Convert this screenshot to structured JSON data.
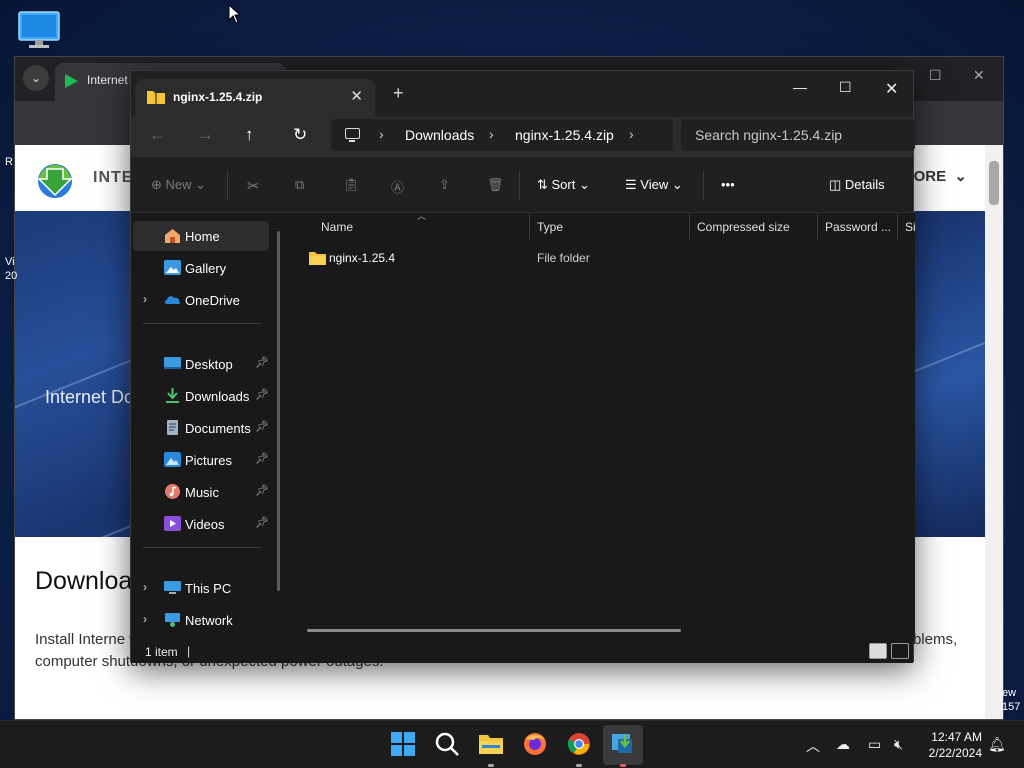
{
  "browser": {
    "tab_title": "Internet",
    "site_name": "INTE",
    "site_more": "ORE",
    "hero_text": "Internet Do",
    "download_title": "Downloa",
    "body_text": "Install Interne                                                                                                     wnloads your files. IDM will also repair broken and resume interrupted downloads due to lost connections, network problems, computer shutdowns, or unexpected power outages.",
    "left_cut": {
      "r": "R",
      "vi": "Vi",
      "num": "20"
    },
    "right_cut": {
      "line1": "ew",
      "line2": "157"
    }
  },
  "explorer": {
    "tab_title": "nginx-1.25.4.zip",
    "breadcrumb": [
      "Downloads",
      "nginx-1.25.4.zip"
    ],
    "search_placeholder": "Search nginx-1.25.4.zip",
    "commands": {
      "new": "New",
      "sort": "Sort",
      "view": "View",
      "more": "•••",
      "details": "Details"
    },
    "nav": {
      "home": "Home",
      "gallery": "Gallery",
      "onedrive": "OneDrive",
      "desktop": "Desktop",
      "downloads": "Downloads",
      "documents": "Documents",
      "pictures": "Pictures",
      "music": "Music",
      "videos": "Videos",
      "thispc": "This PC",
      "network": "Network"
    },
    "columns": [
      "Name",
      "Type",
      "Compressed size",
      "Password ...",
      "Si"
    ],
    "rows": [
      {
        "name": "nginx-1.25.4",
        "type": "File folder"
      }
    ],
    "status": "1 item"
  },
  "taskbar": {
    "time": "12:47 AM",
    "date": "2/22/2024"
  },
  "colors": {
    "explorer_bg": "#191919",
    "folder_yellow": "#f4c43a",
    "accent_blue": "#2b88d8"
  },
  "icons": [
    "computer-icon",
    "folder-icon",
    "search-icon",
    "firefox-icon",
    "chrome-icon",
    "idm-icon",
    "windows-start-icon"
  ]
}
